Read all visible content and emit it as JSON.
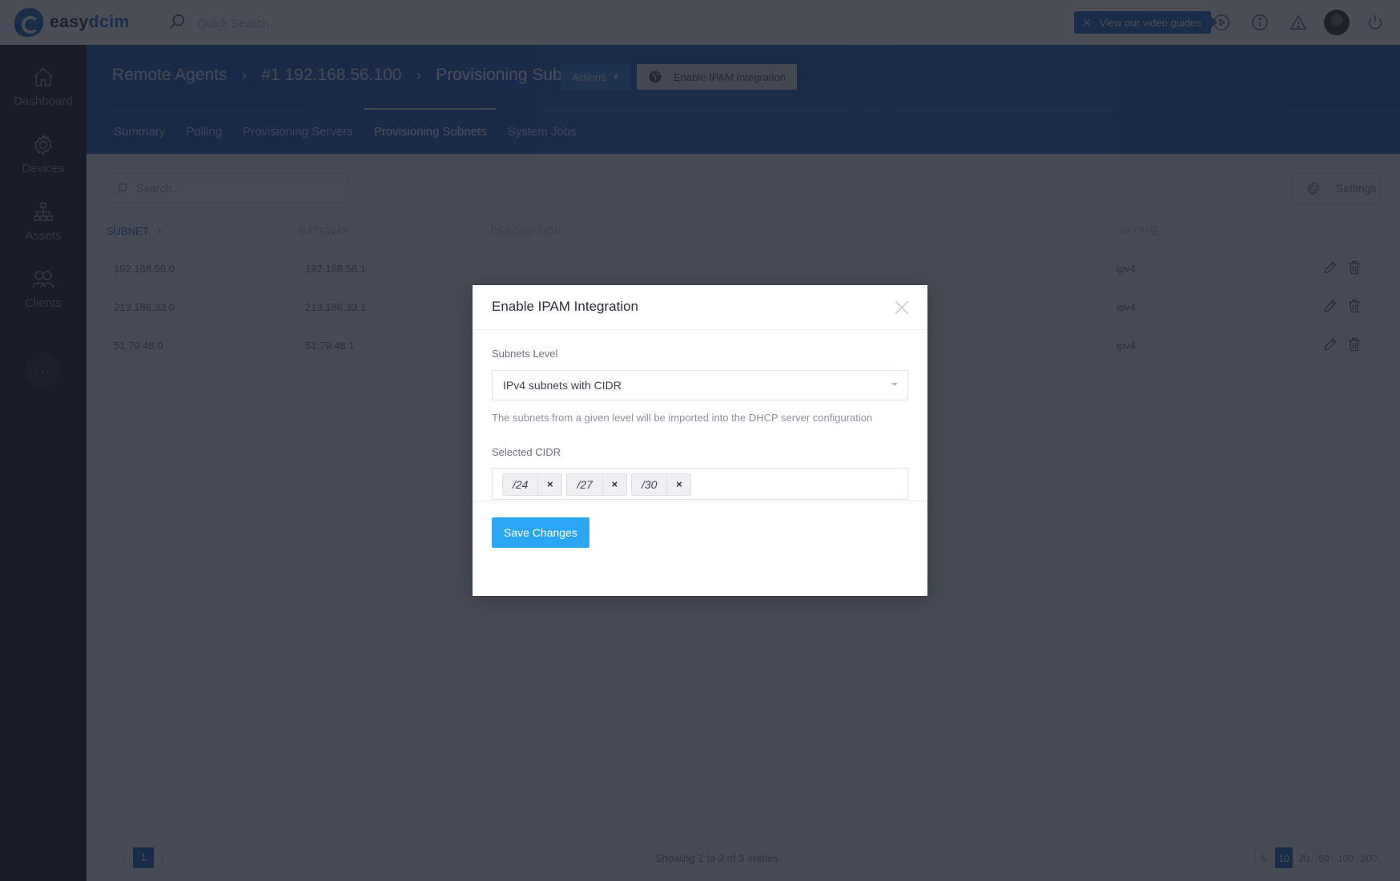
{
  "topbar": {
    "logo_prefix": "easy",
    "logo_suffix": "dcim",
    "quick_search_placeholder": "Quick Search...",
    "video_guide_label": "View our video guides",
    "icons": [
      "play-circle-icon",
      "info-icon",
      "warning-icon",
      "avatar",
      "power-icon"
    ]
  },
  "sidebar": {
    "items": [
      {
        "label": "Dashboard",
        "icon": "home-icon"
      },
      {
        "label": "Devices",
        "icon": "gear-icon"
      },
      {
        "label": "Assets",
        "icon": "sitemap-icon"
      },
      {
        "label": "Clients",
        "icon": "users-icon"
      }
    ],
    "more_label": "..."
  },
  "header": {
    "breadcrumbs": [
      "Remote Agents",
      "#1 192.168.56.100",
      "Provisioning Subnets"
    ],
    "actions_label": "Actions",
    "enable_ipam_label": "Enable IPAM Integration",
    "tabs": [
      {
        "label": "Summary",
        "active": false
      },
      {
        "label": "Polling",
        "active": false
      },
      {
        "label": "Provisioning Servers",
        "active": false
      },
      {
        "label": "Provisioning Subnets",
        "active": true
      },
      {
        "label": "System Jobs",
        "active": false
      }
    ]
  },
  "content": {
    "search_placeholder": "Search...",
    "settings_label": "Settings",
    "columns": [
      "Subnet",
      "Gateway",
      "Description",
      "IP Type"
    ],
    "sort_indicator": "↑",
    "rows": [
      {
        "subnet": "192.168.56.0",
        "gateway": "192.168.56.1",
        "description": "",
        "ip_type": "ipv4"
      },
      {
        "subnet": "213.186.33.0",
        "gateway": "213.186.33.1",
        "description": "",
        "ip_type": "ipv4"
      },
      {
        "subnet": "51.79.48.0",
        "gateway": "51.79.48.1",
        "description": "",
        "ip_type": "ipv4"
      }
    ],
    "pagination": {
      "prev": "‹",
      "next": "›",
      "current_page": "1",
      "showing_text": "Showing 1 to 3 of 3 entries",
      "page_sizes": [
        "5",
        "10",
        "20",
        "50",
        "100",
        "200"
      ],
      "active_page_size": "10"
    }
  },
  "modal": {
    "title": "Enable IPAM Integration",
    "subnets_level_label": "Subnets Level",
    "subnets_level_value": "IPv4 subnets with CIDR",
    "hint": "The subnets from a given level will be imported into the DHCP server configuration",
    "selected_cidr_label": "Selected CIDR",
    "cidr_tags": [
      "/24",
      "/27",
      "/30"
    ],
    "tag_remove_glyph": "×",
    "save_label": "Save Changes"
  },
  "colors": {
    "brand_blue": "#1d63c4",
    "save_button": "#2aa6f5",
    "backdrop": "rgba(24,28,40,0.78)"
  }
}
